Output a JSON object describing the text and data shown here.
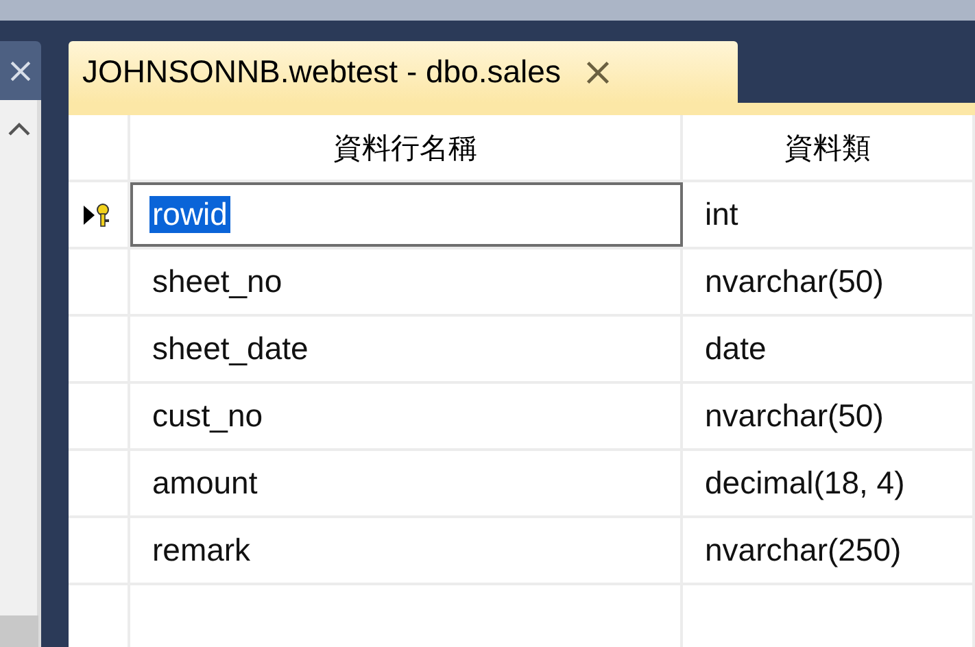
{
  "tab": {
    "title": "JOHNSONNB.webtest - dbo.sales",
    "selected": true
  },
  "table": {
    "columns": [
      "資料行名稱",
      "資料類"
    ],
    "rows": [
      {
        "name": "rowid",
        "type": "int",
        "selected": true,
        "primary_key": true
      },
      {
        "name": "sheet_no",
        "type": "nvarchar(50)",
        "selected": false,
        "primary_key": false
      },
      {
        "name": "sheet_date",
        "type": "date",
        "selected": false,
        "primary_key": false
      },
      {
        "name": "cust_no",
        "type": "nvarchar(50)",
        "selected": false,
        "primary_key": false
      },
      {
        "name": "amount",
        "type": "decimal(18, 4)",
        "selected": false,
        "primary_key": false
      },
      {
        "name": "remark",
        "type": "nvarchar(250)",
        "selected": false,
        "primary_key": false
      }
    ]
  }
}
